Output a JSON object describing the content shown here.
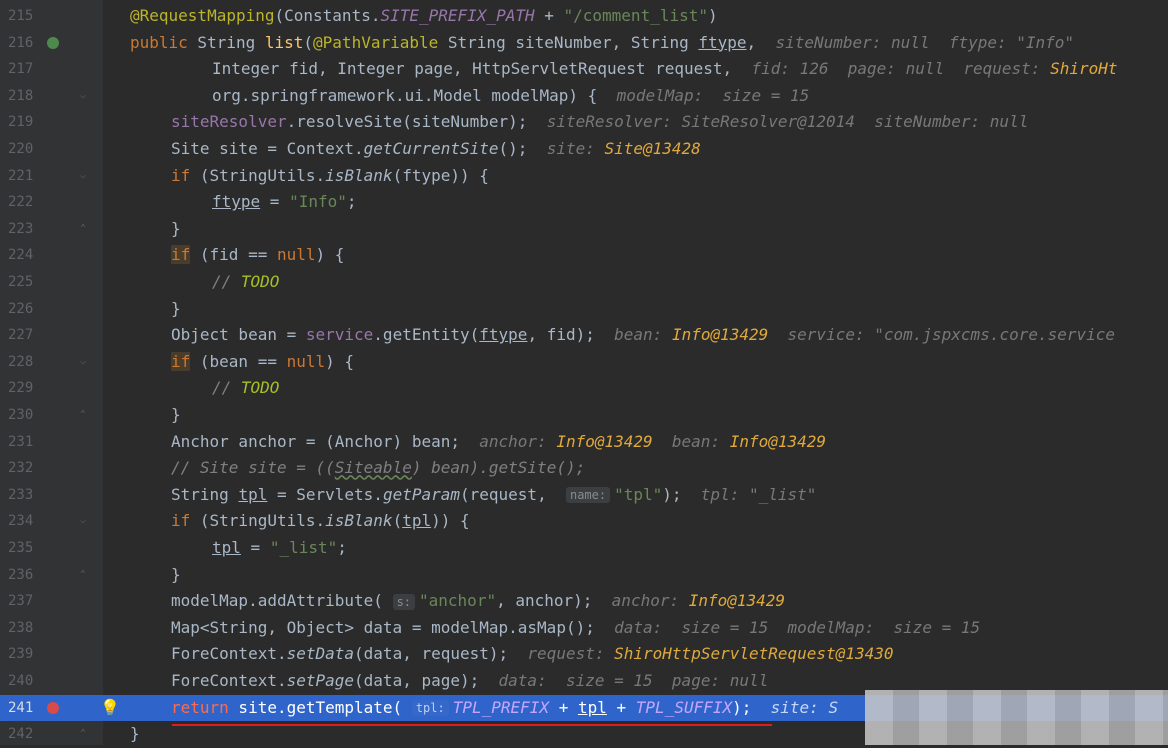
{
  "lines": [
    {
      "num": "215",
      "segs": [
        {
          "t": "@RequestMapping",
          "c": "ann"
        },
        {
          "t": "(Constants."
        },
        {
          "t": "SITE_PREFIX_PATH",
          "c": "cst"
        },
        {
          "t": " + "
        },
        {
          "t": "\"/comment_list\"",
          "c": "str"
        },
        {
          "t": ")"
        }
      ]
    },
    {
      "num": "216",
      "segs": [
        {
          "t": "public",
          "c": "kw"
        },
        {
          "t": " String "
        },
        {
          "t": "list",
          "c": "fn"
        },
        {
          "t": "("
        },
        {
          "t": "@PathVariable",
          "c": "ann"
        },
        {
          "t": " String siteNumber, String "
        },
        {
          "t": "ftype",
          "c": "ul"
        },
        {
          "t": ",  "
        },
        {
          "t": "siteNumber: null  ftype: \"Info\"",
          "c": "hint"
        }
      ]
    },
    {
      "num": "217",
      "segs": [
        {
          "t": "Integer fid, Integer page, HttpServletRequest request,  "
        },
        {
          "t": "fid: 126  page: null  request: ",
          "c": "hint"
        },
        {
          "t": "ShiroHt",
          "c": "hobj"
        }
      ]
    },
    {
      "num": "218",
      "segs": [
        {
          "t": "org.springframework.ui.Model modelMap) {  "
        },
        {
          "t": "modelMap:  size = 15",
          "c": "hint"
        }
      ]
    },
    {
      "num": "219",
      "segs": [
        {
          "t": "siteResolver",
          "c": "fld"
        },
        {
          "t": ".resolveSite(siteNumber);  "
        },
        {
          "t": "siteResolver: SiteResolver@12014  siteNumber: null",
          "c": "hint"
        }
      ]
    },
    {
      "num": "220",
      "segs": [
        {
          "t": "Site site = Context."
        },
        {
          "t": "getCurrentSite",
          "c": "it"
        },
        {
          "t": "();  "
        },
        {
          "t": "site: ",
          "c": "hint"
        },
        {
          "t": "Site@13428",
          "c": "hobj"
        }
      ]
    },
    {
      "num": "221",
      "segs": [
        {
          "t": "if",
          "c": "kw"
        },
        {
          "t": " (StringUtils."
        },
        {
          "t": "isBlank",
          "c": "it"
        },
        {
          "t": "(ftype)) {"
        }
      ]
    },
    {
      "num": "222",
      "segs": [
        {
          "t": "ftype",
          "c": "ul"
        },
        {
          "t": " = "
        },
        {
          "t": "\"Info\"",
          "c": "str"
        },
        {
          "t": ";"
        }
      ]
    },
    {
      "num": "223",
      "segs": [
        {
          "t": "}"
        }
      ]
    },
    {
      "num": "224",
      "segs": [
        {
          "t": "if",
          "c": "kw ifhl"
        },
        {
          "t": " (fid == "
        },
        {
          "t": "null",
          "c": "kw"
        },
        {
          "t": ") {"
        }
      ]
    },
    {
      "num": "225",
      "segs": [
        {
          "t": "// ",
          "c": "com"
        },
        {
          "t": "TODO",
          "c": "todo"
        }
      ]
    },
    {
      "num": "226",
      "segs": [
        {
          "t": "}"
        }
      ]
    },
    {
      "num": "227",
      "segs": [
        {
          "t": "Object bean = "
        },
        {
          "t": "service",
          "c": "fld"
        },
        {
          "t": ".getEntity("
        },
        {
          "t": "ftype",
          "c": "ul"
        },
        {
          "t": ", fid);  "
        },
        {
          "t": "bean: ",
          "c": "hint"
        },
        {
          "t": "Info@13429",
          "c": "hobj"
        },
        {
          "t": "  service: \"com.jspxcms.core.service",
          "c": "hint"
        }
      ]
    },
    {
      "num": "228",
      "segs": [
        {
          "t": "if",
          "c": "kw ifhl"
        },
        {
          "t": " (bean == "
        },
        {
          "t": "null",
          "c": "kw"
        },
        {
          "t": ") {"
        }
      ]
    },
    {
      "num": "229",
      "segs": [
        {
          "t": "// ",
          "c": "com"
        },
        {
          "t": "TODO",
          "c": "todo"
        }
      ]
    },
    {
      "num": "230",
      "segs": [
        {
          "t": "}"
        }
      ]
    },
    {
      "num": "231",
      "segs": [
        {
          "t": "Anchor anchor = (Anchor) bean;  "
        },
        {
          "t": "anchor: ",
          "c": "hint"
        },
        {
          "t": "Info@13429",
          "c": "hobj"
        },
        {
          "t": "  bean: ",
          "c": "hint"
        },
        {
          "t": "Info@13429",
          "c": "hobj"
        }
      ]
    },
    {
      "num": "232",
      "segs": [
        {
          "t": "// Site site = ((",
          "c": "com"
        },
        {
          "t": "Siteable",
          "c": "com wavy"
        },
        {
          "t": ") bean).getSite();",
          "c": "com"
        }
      ]
    },
    {
      "num": "233",
      "segs": [
        {
          "t": "String "
        },
        {
          "t": "tpl",
          "c": "ul"
        },
        {
          "t": " = Servlets."
        },
        {
          "t": "getParam",
          "c": "it"
        },
        {
          "t": "(request,  "
        },
        {
          "t": "name:",
          "c": "chip"
        },
        {
          "t": "\"tpl\"",
          "c": "str"
        },
        {
          "t": ");  "
        },
        {
          "t": "tpl: \"_list\"",
          "c": "hint"
        }
      ]
    },
    {
      "num": "234",
      "segs": [
        {
          "t": "if",
          "c": "kw"
        },
        {
          "t": " (StringUtils."
        },
        {
          "t": "isBlank",
          "c": "it"
        },
        {
          "t": "("
        },
        {
          "t": "tpl",
          "c": "ul"
        },
        {
          "t": ")) {"
        }
      ]
    },
    {
      "num": "235",
      "segs": [
        {
          "t": "tpl",
          "c": "ul"
        },
        {
          "t": " = "
        },
        {
          "t": "\"_list\"",
          "c": "str"
        },
        {
          "t": ";"
        }
      ]
    },
    {
      "num": "236",
      "segs": [
        {
          "t": "}"
        }
      ]
    },
    {
      "num": "237",
      "segs": [
        {
          "t": "modelMap.addAttribute( "
        },
        {
          "t": "s:",
          "c": "chip"
        },
        {
          "t": "\"anchor\"",
          "c": "str"
        },
        {
          "t": ", anchor);  "
        },
        {
          "t": "anchor: ",
          "c": "hint"
        },
        {
          "t": "Info@13429",
          "c": "hobj"
        }
      ]
    },
    {
      "num": "238",
      "segs": [
        {
          "t": "Map<String, Object> data = modelMap.asMap();  "
        },
        {
          "t": "data:  size = 15  modelMap:  size = 15",
          "c": "hint"
        }
      ]
    },
    {
      "num": "239",
      "segs": [
        {
          "t": "ForeContext."
        },
        {
          "t": "setData",
          "c": "it"
        },
        {
          "t": "(data, request);  "
        },
        {
          "t": "request: ",
          "c": "hint"
        },
        {
          "t": "ShiroHttpServletRequest@13430",
          "c": "hobj"
        }
      ]
    },
    {
      "num": "240",
      "segs": [
        {
          "t": "ForeContext."
        },
        {
          "t": "setPage",
          "c": "it"
        },
        {
          "t": "(data, page);  "
        },
        {
          "t": "data:  size = 15  page: null",
          "c": "hint"
        }
      ]
    },
    {
      "num": "241",
      "segs": [
        {
          "t": "return",
          "c": "kw"
        },
        {
          "t": " site.getTemplate( "
        },
        {
          "t": "tpl:",
          "c": "chip"
        },
        {
          "t": "TPL_PREFIX",
          "c": "cst"
        },
        {
          "t": " + "
        },
        {
          "t": "tpl",
          "c": "ul"
        },
        {
          "t": " + "
        },
        {
          "t": "TPL_SUFFIX",
          "c": "cst"
        },
        {
          "t": ");  "
        },
        {
          "t": "site: S",
          "c": "hint"
        }
      ]
    },
    {
      "num": "242",
      "segs": [
        {
          "t": "}"
        }
      ]
    }
  ],
  "gutter_icons": {
    "override_icon": "override-method-icon",
    "breakpoint_icon": "breakpoint-icon",
    "bulb_icon": "lightbulb-icon"
  },
  "colors": {
    "background": "#2b2b2b",
    "current_line": "#2f65ca",
    "keyword": "#cc7832",
    "string": "#6a8759",
    "annotation": "#bbb529",
    "method": "#ffc66d"
  }
}
